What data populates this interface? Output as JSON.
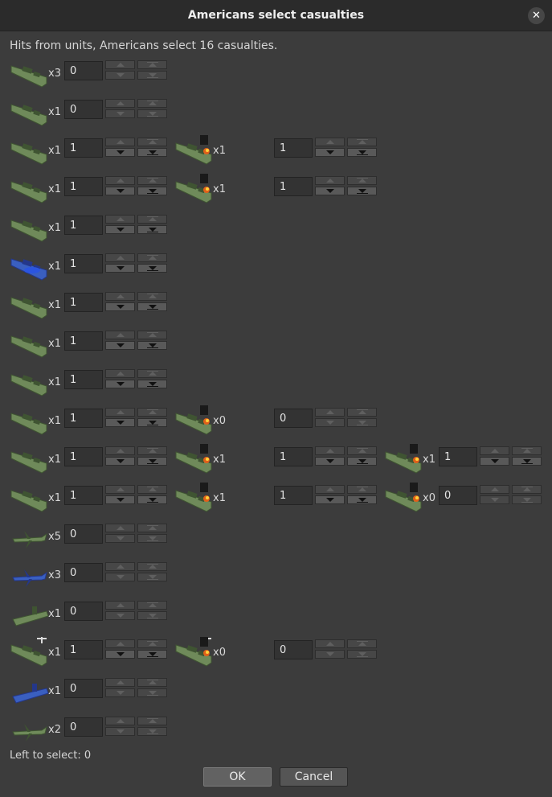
{
  "window": {
    "title": "Americans select casualties",
    "close_icon": "close-icon"
  },
  "message": "Hits from units,  Americans select 16 casualties.",
  "rows": [
    {
      "units": [
        {
          "icon": "battleship-icon",
          "color": "green",
          "count": "x3",
          "value": "0",
          "up": false,
          "down": false
        }
      ]
    },
    {
      "units": [
        {
          "icon": "battleship-icon",
          "color": "green",
          "count": "x1",
          "value": "0",
          "up": false,
          "down": false
        }
      ]
    },
    {
      "units": [
        {
          "icon": "battleship-icon",
          "color": "green",
          "count": "x1",
          "value": "1",
          "up": false,
          "down": true
        },
        {
          "icon": "damaged-battleship-icon",
          "color": "green",
          "count": "x1",
          "value": "1",
          "up": false,
          "down": true
        }
      ]
    },
    {
      "units": [
        {
          "icon": "battleship-icon",
          "color": "green",
          "count": "x1",
          "value": "1",
          "up": false,
          "down": true
        },
        {
          "icon": "damaged-battleship-icon",
          "color": "green",
          "count": "x1",
          "value": "1",
          "up": false,
          "down": true
        }
      ]
    },
    {
      "units": [
        {
          "icon": "aircraft-carrier-icon",
          "color": "green",
          "count": "x1",
          "value": "1",
          "up": false,
          "down": true
        }
      ]
    },
    {
      "units": [
        {
          "icon": "transport-ship-icon",
          "color": "blue",
          "count": "x1",
          "value": "1",
          "up": false,
          "down": true
        }
      ]
    },
    {
      "units": [
        {
          "icon": "destroyer-icon",
          "color": "green",
          "count": "x1",
          "value": "1",
          "up": false,
          "down": true
        }
      ]
    },
    {
      "units": [
        {
          "icon": "cruiser-icon",
          "color": "green",
          "count": "x1",
          "value": "1",
          "up": false,
          "down": true
        }
      ]
    },
    {
      "units": [
        {
          "icon": "cruiser-icon",
          "color": "green",
          "count": "x1",
          "value": "1",
          "up": false,
          "down": true
        }
      ]
    },
    {
      "units": [
        {
          "icon": "battleship-icon",
          "color": "green",
          "count": "x1",
          "value": "1",
          "up": false,
          "down": true
        },
        {
          "icon": "damaged-battleship-icon",
          "color": "green",
          "count": "x0",
          "value": "0",
          "up": false,
          "down": false
        }
      ]
    },
    {
      "units": [
        {
          "icon": "battleship-icon",
          "color": "green",
          "count": "x1",
          "value": "1",
          "up": false,
          "down": true
        },
        {
          "icon": "damaged-battleship-icon",
          "color": "green",
          "count": "x1",
          "value": "1",
          "up": false,
          "down": true
        },
        {
          "icon": "damaged-battleship-icon",
          "color": "green",
          "count": "x1",
          "value": "1",
          "up": false,
          "down": true
        }
      ]
    },
    {
      "units": [
        {
          "icon": "battleship-icon",
          "color": "green",
          "count": "x1",
          "value": "1",
          "up": false,
          "down": true
        },
        {
          "icon": "damaged-battleship-icon",
          "color": "green",
          "count": "x1",
          "value": "1",
          "up": false,
          "down": true
        },
        {
          "icon": "damaged-battleship-icon",
          "color": "green",
          "count": "x0",
          "value": "0",
          "up": false,
          "down": false
        }
      ]
    },
    {
      "units": [
        {
          "icon": "fighter-plane-icon",
          "color": "green",
          "count": "x5",
          "value": "0",
          "up": false,
          "down": false
        }
      ]
    },
    {
      "units": [
        {
          "icon": "fighter-plane-icon",
          "color": "blue",
          "count": "x3",
          "value": "0",
          "up": false,
          "down": false
        }
      ]
    },
    {
      "units": [
        {
          "icon": "submarine-icon",
          "color": "green",
          "count": "x1",
          "value": "0",
          "up": false,
          "down": false
        }
      ]
    },
    {
      "units": [
        {
          "icon": "carrier-with-plane-icon",
          "color": "green",
          "count": "x1",
          "value": "1",
          "up": false,
          "down": true
        },
        {
          "icon": "damaged-carrier-with-plane-icon",
          "color": "green",
          "count": "x0",
          "value": "0",
          "up": false,
          "down": false
        }
      ]
    },
    {
      "units": [
        {
          "icon": "submarine-icon",
          "color": "blue",
          "count": "x1",
          "value": "0",
          "up": false,
          "down": false
        }
      ]
    },
    {
      "units": [
        {
          "icon": "bomber-plane-icon",
          "color": "green",
          "count": "x2",
          "value": "0",
          "up": false,
          "down": false
        }
      ]
    }
  ],
  "footer": {
    "left_to_select": "Left to select: 0"
  },
  "buttons": {
    "ok": "OK",
    "cancel": "Cancel"
  },
  "colors": {
    "background": "#3c3c3c",
    "titlebar": "#2b2b2b",
    "unit_green": "#6f8a5a",
    "unit_blue": "#3a5fc0",
    "fire": "#e0601a"
  }
}
